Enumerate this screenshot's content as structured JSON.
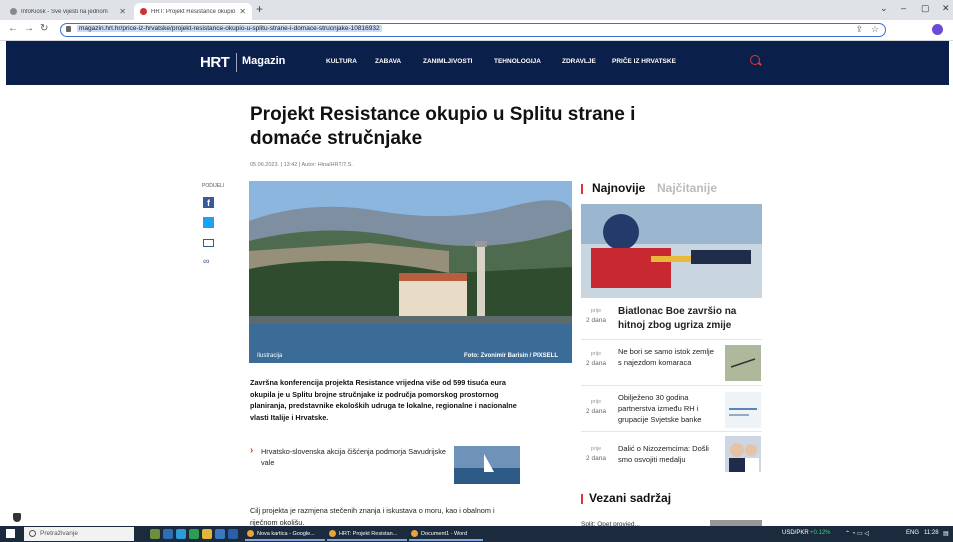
{
  "browser": {
    "tabs": [
      {
        "title": "InfoKiosk - Sve vijesti na jednom"
      },
      {
        "title": "HRT: Projekt Resistance okupio u..."
      }
    ],
    "url": "magazin.hrt.hr/price-iz-hrvatske/projekt-resistance-okupio-u-splitu-strane-i-domace-strucnjake-10816932"
  },
  "nav": {
    "logo": "HRT",
    "section": "Magazin",
    "items": [
      "KULTURA",
      "ZABAVA",
      "ZANIMLJIVOSTI",
      "TEHNOLOGIJA",
      "ZDRAVLJE",
      "PRIČE IZ HRVATSKE"
    ]
  },
  "article": {
    "title": "Projekt Resistance okupio u Splitu strane i domaće stručnjake",
    "date": "05.06.2023.",
    "time": "13:42",
    "author": "Autor: Hina/HRT/T.S.",
    "share_label": "PODIJELI",
    "image_caption_left": "Ilustracija",
    "image_caption_right": "Foto: Zvonimir Barisin / PIXSELL",
    "lead": "Završna konferencija projekta Resistance vrijedna više od 599 tisuća eura okupila je u Splitu brojne stručnjake iz područja pomorskog prostornog planiranja, predstavnike ekoloških udruga te lokalne, regionalne i nacionalne vlasti Italije i Hrvatske.",
    "related_link": "Hrvatsko-slovenska akcija čišćenja podmorja Savudrijske vale",
    "body": "Cilj projekta je razmjena stečenih znanja i iskustava o moru, kao i obalnom i riječnom okolišu."
  },
  "sidebar": {
    "tab_latest": "Najnovije",
    "tab_most_read": "Najčitanije",
    "items": [
      {
        "when_label": "prije",
        "when": "2 dana",
        "headline": "Biatlonac Boe završio na hitnoj zbog ugriza zmije"
      },
      {
        "when_label": "prije",
        "when": "2 dana",
        "headline": "Ne bori se samo istok zemlje s najezdom komaraca"
      },
      {
        "when_label": "prije",
        "when": "2 dana",
        "headline": "Obilježeno 30 godina partnerstva između RH i grupacije Svjetske banke"
      },
      {
        "when_label": "prije",
        "when": "2 dana",
        "headline": "Dalić o Nizozemcima: Došli smo osvojiti medalju"
      }
    ],
    "related_title": "Vezani sadržaj",
    "related_first": "Split: Opet provjed..."
  },
  "taskbar": {
    "search_placeholder": "Pretraživanje",
    "apps": [
      "Nova kartica - Google...",
      "HRT: Projekt Resistan...",
      "Document1 - Word"
    ],
    "ticker": "USD/PKR",
    "ticker_change": "+0.12%",
    "lang": "ENG",
    "time": "11:28"
  }
}
